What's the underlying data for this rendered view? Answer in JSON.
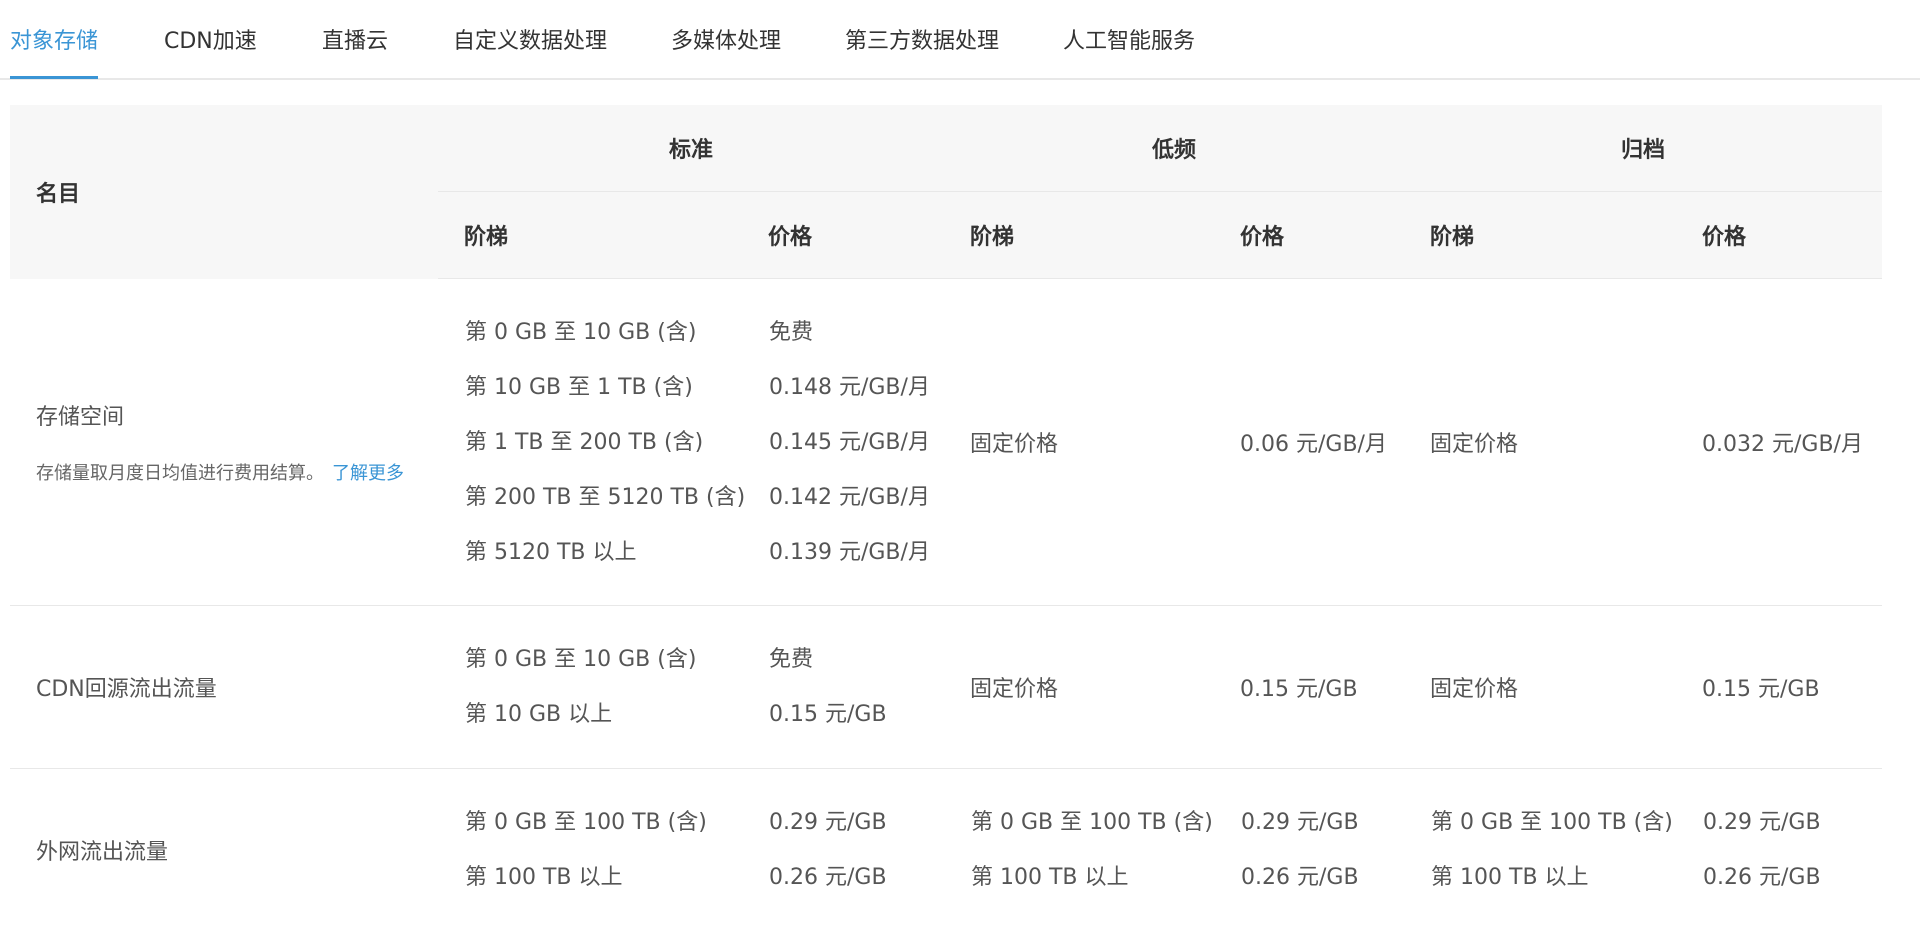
{
  "tabs": [
    {
      "label": "对象存储",
      "active": true
    },
    {
      "label": "CDN加速"
    },
    {
      "label": "直播云"
    },
    {
      "label": "自定义数据处理"
    },
    {
      "label": "多媒体处理"
    },
    {
      "label": "第三方数据处理"
    },
    {
      "label": "人工智能服务"
    }
  ],
  "colors": {
    "accent": "#3a95d5",
    "header_bg": "#f7f7f7",
    "border": "#e8e8e8"
  },
  "table": {
    "name_header": "名目",
    "groups": [
      "标准",
      "低频",
      "归档"
    ],
    "sub_headers": [
      "阶梯",
      "价格",
      "阶梯",
      "价格",
      "阶梯",
      "价格"
    ],
    "rows": [
      {
        "name": "存储空间",
        "note": "存储量取月度日均值进行费用结算。",
        "note_link": "了解更多",
        "std_tiers": [
          "第 0 GB 至 10 GB (含)",
          "第 10 GB 至 1 TB (含)",
          "第 1 TB 至 200 TB (含)",
          "第 200 TB 至 5120 TB (含)",
          "第 5120 TB 以上"
        ],
        "std_prices": [
          "免费",
          "0.148 元/GB/月",
          "0.145 元/GB/月",
          "0.142 元/GB/月",
          "0.139 元/GB/月"
        ],
        "low_tier": "固定价格",
        "low_price": "0.06 元/GB/月",
        "arc_tier": "固定价格",
        "arc_price": "0.032 元/GB/月"
      },
      {
        "name": "CDN回源流出流量",
        "std_tiers": [
          "第 0 GB 至 10 GB (含)",
          "第 10 GB 以上"
        ],
        "std_prices": [
          "免费",
          "0.15 元/GB"
        ],
        "low_tier": "固定价格",
        "low_price": "0.15 元/GB",
        "arc_tier": "固定价格",
        "arc_price": "0.15 元/GB"
      },
      {
        "name": "外网流出流量",
        "std_tiers": [
          "第 0 GB 至 100 TB (含)",
          "第 100 TB 以上"
        ],
        "std_prices": [
          "0.29 元/GB",
          "0.26 元/GB"
        ],
        "low_tiers": [
          "第 0 GB 至 100 TB (含)",
          "第 100 TB 以上"
        ],
        "low_prices": [
          "0.29 元/GB",
          "0.26 元/GB"
        ],
        "arc_tiers": [
          "第 0 GB 至 100 TB (含)",
          "第 100 TB 以上"
        ],
        "arc_prices": [
          "0.29 元/GB",
          "0.26 元/GB"
        ]
      }
    ]
  }
}
